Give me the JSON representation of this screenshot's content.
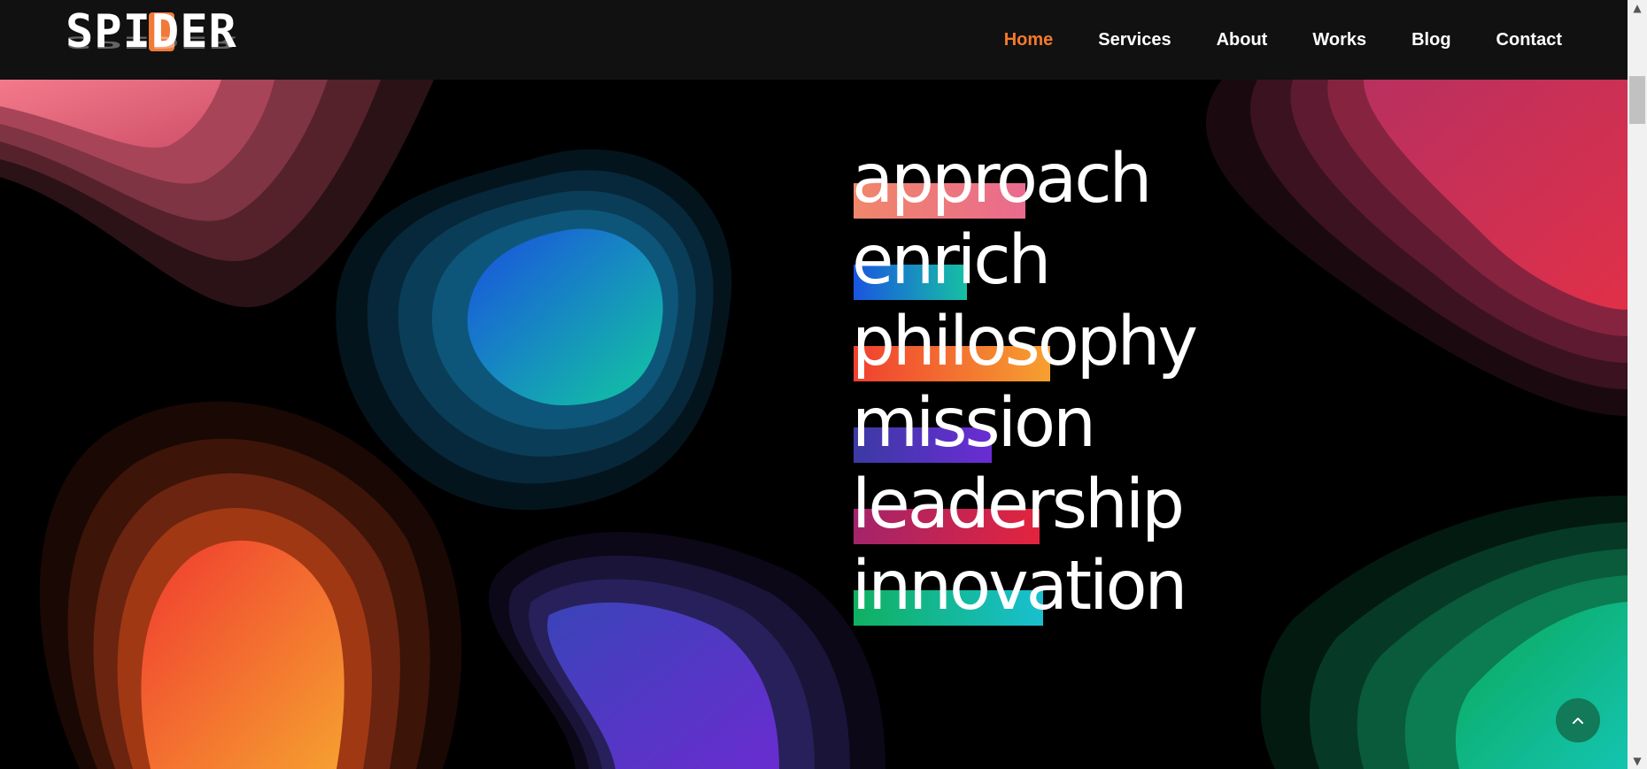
{
  "brand": {
    "logo_text": "SPIDER",
    "accent": "#f47a2b"
  },
  "nav": {
    "items": [
      {
        "label": "Home",
        "active": true
      },
      {
        "label": "Services",
        "active": false
      },
      {
        "label": "About",
        "active": false
      },
      {
        "label": "Works",
        "active": false
      },
      {
        "label": "Blog",
        "active": false
      },
      {
        "label": "Contact",
        "active": false
      }
    ]
  },
  "hero": {
    "words": [
      {
        "text": "approach",
        "gradient": [
          "#f0876a",
          "#ea6a8e"
        ]
      },
      {
        "text": "enrich",
        "gradient": [
          "#1a55e0",
          "#16c0a4"
        ]
      },
      {
        "text": "philosophy",
        "gradient": [
          "#f04030",
          "#f6a030"
        ]
      },
      {
        "text": "mission",
        "gradient": [
          "#3b3aa4",
          "#6a2cd4"
        ]
      },
      {
        "text": "leadership",
        "gradient": [
          "#a3246a",
          "#e2243e"
        ]
      },
      {
        "text": "innovation",
        "gradient": [
          "#10b060",
          "#18c0d0"
        ]
      }
    ]
  },
  "icons": {
    "to_top": "chevron-up-icon",
    "scroll_up": "scroll-up-arrow-icon",
    "scroll_down": "scroll-down-arrow-icon"
  },
  "colors": {
    "header_bg": "#111111",
    "page_bg": "#000000",
    "to_top_bg": "#127a58"
  }
}
